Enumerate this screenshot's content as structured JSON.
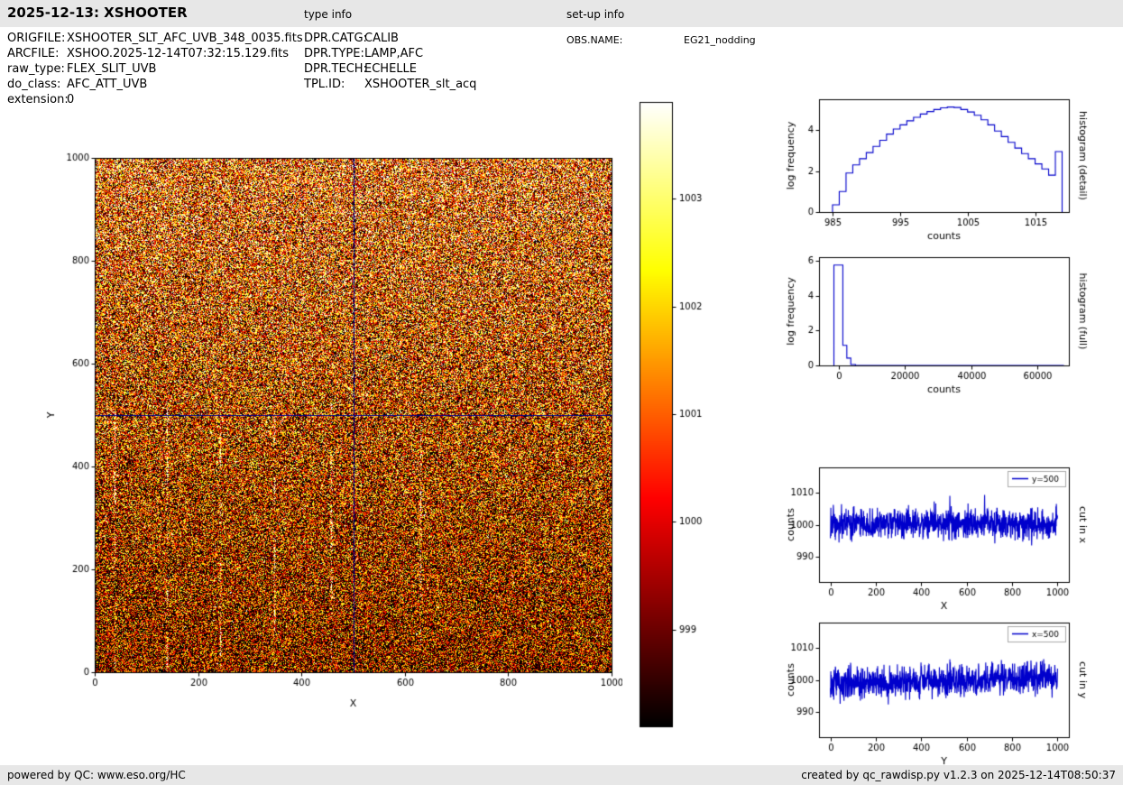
{
  "header": {
    "title": "2025-12-13: XSHOOTER",
    "type_info_label": "type info",
    "setup_info_label": "set-up info"
  },
  "metadata": {
    "left": [
      {
        "label": "ORIGFILE:",
        "value": "XSHOOTER_SLT_AFC_UVB_348_0035.fits"
      },
      {
        "label": "ARCFILE:",
        "value": "XSHOO.2025-12-14T07:32:15.129.fits"
      },
      {
        "label": "raw_type:",
        "value": "FLEX_SLIT_UVB"
      },
      {
        "label": "do_class:",
        "value": "AFC_ATT_UVB"
      },
      {
        "label": "extension:",
        "value": "0"
      }
    ],
    "middle": [
      {
        "label": "DPR.CATG:",
        "value": "CALIB"
      },
      {
        "label": "DPR.TYPE:",
        "value": "LAMP,AFC"
      },
      {
        "label": "DPR.TECH:",
        "value": "ECHELLE"
      },
      {
        "label": "TPL.ID:",
        "value": "XSHOOTER_slt_acq"
      }
    ],
    "right": [
      {
        "label": "OBS.NAME:",
        "value": "EG21_nodding"
      }
    ]
  },
  "footer": {
    "left": "powered by QC: www.eso.org/HC",
    "right": "created by qc_rawdisp.py v1.2.3 on 2025-12-14T08:50:37"
  },
  "colors": {
    "bar_background": "#e7e7e7",
    "plot_line": "#0000cc",
    "crosshair": "#00008b"
  },
  "chart_data": [
    {
      "id": "raw_image",
      "type": "heatmap",
      "xlabel": "X",
      "ylabel": "Y",
      "xlim": [
        0,
        1000
      ],
      "ylim": [
        0,
        1000
      ],
      "xticks": [
        0,
        200,
        400,
        600,
        800,
        1000
      ],
      "yticks": [
        0,
        200,
        400,
        600,
        800,
        1000
      ],
      "colormap": "hot",
      "colorbar": {
        "range": [
          998.1,
          1003.9
        ],
        "ticks": [
          999,
          1000,
          1001,
          1002,
          1003
        ]
      },
      "background": {
        "counts_bottom": 999.2,
        "counts_top": 1001.1,
        "noise_amplitude": 7
      },
      "crosshair": {
        "x": 500,
        "y": 500,
        "color": "#00008b"
      },
      "streaks": {
        "x_positions": [
          38,
          140,
          243,
          348,
          458,
          630
        ],
        "y_range": [
          0,
          520
        ]
      },
      "seed": 20251213
    },
    {
      "id": "histogram_detail",
      "type": "step",
      "xlabel": "counts",
      "ylabel": "log frequency",
      "right_label": "histogram (detail)",
      "xlim": [
        983,
        1020
      ],
      "ylim": [
        0,
        5.5
      ],
      "xticks": [
        985,
        995,
        1005,
        1015
      ],
      "yticks": [
        0,
        2,
        4
      ],
      "line_color": "#0000cc",
      "bins": {
        "start": 985,
        "width": 1,
        "heights": [
          0.35,
          1.0,
          1.9,
          2.3,
          2.6,
          2.9,
          3.2,
          3.5,
          3.8,
          4.05,
          4.25,
          4.45,
          4.62,
          4.78,
          4.9,
          5.0,
          5.08,
          5.12,
          5.1,
          5.0,
          4.88,
          4.72,
          4.5,
          4.25,
          3.95,
          3.68,
          3.4,
          3.12,
          2.85,
          2.6,
          2.35,
          2.1,
          1.8,
          2.95
        ]
      }
    },
    {
      "id": "histogram_full",
      "type": "step",
      "xlabel": "counts",
      "ylabel": "log frequency",
      "right_label": "histogram (full)",
      "xlim": [
        -6000,
        69500
      ],
      "ylim": [
        0,
        6.2
      ],
      "xticks": [
        0,
        20000,
        40000,
        60000
      ],
      "yticks": [
        0,
        2,
        4,
        6
      ],
      "line_color": "#0000cc",
      "path": [
        [
          -1500,
          0
        ],
        [
          -1500,
          5.75
        ],
        [
          1200,
          5.75
        ],
        [
          1200,
          1.15
        ],
        [
          2400,
          1.15
        ],
        [
          2400,
          0.42
        ],
        [
          3600,
          0.42
        ],
        [
          3600,
          0.05
        ],
        [
          5000,
          0.05
        ],
        [
          5000,
          0
        ],
        [
          68000,
          0
        ]
      ]
    },
    {
      "id": "cut_x",
      "type": "line",
      "xlabel": "X",
      "ylabel": "counts",
      "right_label": "cut in x",
      "legend": {
        "label": "y=500"
      },
      "xlim": [
        -50,
        1050
      ],
      "ylim": [
        982,
        1018
      ],
      "xticks": [
        0,
        200,
        400,
        600,
        800,
        1000
      ],
      "yticks": [
        990,
        1000,
        1010
      ],
      "line_color": "#0000cc",
      "series_gen": {
        "n": 1000,
        "mean": 1000.3,
        "std": 2.4,
        "trend": 0,
        "spike_prob": 0.05,
        "spike_amp": 9,
        "seed": 424242
      }
    },
    {
      "id": "cut_y",
      "type": "line",
      "xlabel": "Y",
      "ylabel": "counts",
      "right_label": "cut in y",
      "legend": {
        "label": "x=500"
      },
      "xlim": [
        -50,
        1050
      ],
      "ylim": [
        982,
        1018
      ],
      "xticks": [
        0,
        200,
        400,
        600,
        800,
        1000
      ],
      "yticks": [
        990,
        1000,
        1010
      ],
      "line_color": "#0000cc",
      "series_gen": {
        "n": 1000,
        "mean": 999.8,
        "std": 2.4,
        "trend": 2.2,
        "spike_prob": 0.05,
        "spike_amp": 9,
        "seed": 777001
      }
    }
  ]
}
